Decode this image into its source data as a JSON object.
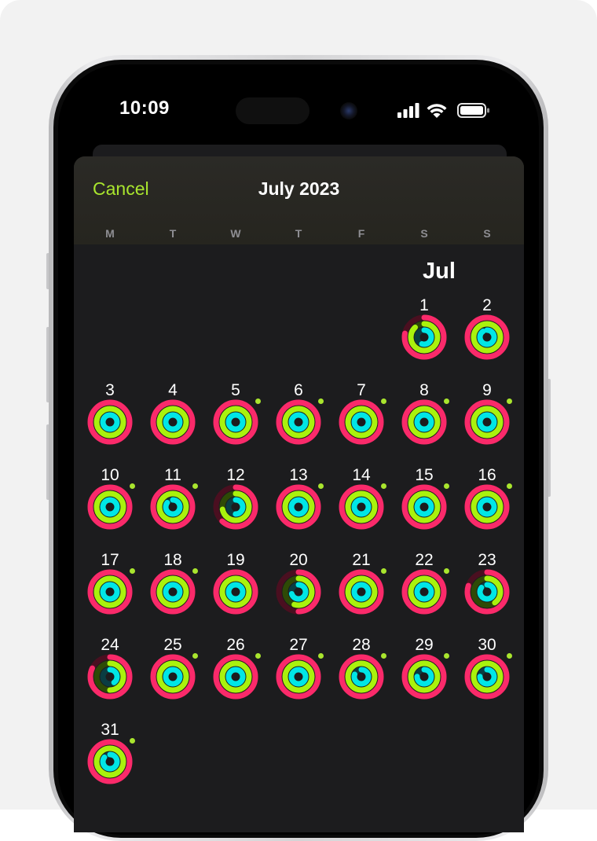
{
  "status_bar": {
    "time": "10:09",
    "icons": [
      "cellular-signal-icon",
      "wifi-icon",
      "battery-icon"
    ]
  },
  "header": {
    "cancel_label": "Cancel",
    "title": "July 2023"
  },
  "weekdays": [
    "M",
    "T",
    "W",
    "T",
    "F",
    "S",
    "S"
  ],
  "month_label": "Jul",
  "colors": {
    "move": "#fa2a6a",
    "move_track": "#4a0f20",
    "exercise": "#a9f20d",
    "exercise_track": "#2e4a06",
    "stand": "#00e6e6",
    "stand_track": "#0a3d42",
    "accent": "#a9e52e",
    "background": "#1c1c1e"
  },
  "days": [
    {
      "date": "1",
      "move": 0.78,
      "exercise": 0.88,
      "stand": 0.55,
      "badge": false
    },
    {
      "date": "2",
      "move": 1.0,
      "exercise": 1.0,
      "stand": 0.9,
      "badge": false
    },
    {
      "date": "3",
      "move": 1.0,
      "exercise": 1.0,
      "stand": 1.0,
      "badge": false
    },
    {
      "date": "4",
      "move": 1.0,
      "exercise": 1.0,
      "stand": 1.0,
      "badge": false
    },
    {
      "date": "5",
      "move": 1.0,
      "exercise": 1.0,
      "stand": 1.0,
      "badge": true
    },
    {
      "date": "6",
      "move": 1.0,
      "exercise": 1.0,
      "stand": 1.0,
      "badge": true
    },
    {
      "date": "7",
      "move": 1.0,
      "exercise": 1.0,
      "stand": 1.0,
      "badge": true
    },
    {
      "date": "8",
      "move": 1.0,
      "exercise": 1.0,
      "stand": 1.0,
      "badge": true
    },
    {
      "date": "9",
      "move": 1.0,
      "exercise": 1.0,
      "stand": 1.0,
      "badge": true
    },
    {
      "date": "10",
      "move": 1.0,
      "exercise": 1.0,
      "stand": 1.0,
      "badge": true
    },
    {
      "date": "11",
      "move": 1.0,
      "exercise": 1.0,
      "stand": 0.85,
      "badge": true
    },
    {
      "date": "12",
      "move": 0.62,
      "exercise": 0.72,
      "stand": 0.5,
      "badge": false
    },
    {
      "date": "13",
      "move": 1.0,
      "exercise": 1.0,
      "stand": 1.0,
      "badge": true
    },
    {
      "date": "14",
      "move": 1.0,
      "exercise": 1.0,
      "stand": 1.0,
      "badge": true
    },
    {
      "date": "15",
      "move": 1.0,
      "exercise": 1.0,
      "stand": 1.0,
      "badge": true
    },
    {
      "date": "16",
      "move": 1.0,
      "exercise": 1.0,
      "stand": 1.0,
      "badge": true
    },
    {
      "date": "17",
      "move": 1.0,
      "exercise": 1.0,
      "stand": 1.0,
      "badge": true
    },
    {
      "date": "18",
      "move": 1.0,
      "exercise": 1.0,
      "stand": 1.0,
      "badge": true
    },
    {
      "date": "19",
      "move": 1.0,
      "exercise": 1.0,
      "stand": 1.0,
      "badge": false
    },
    {
      "date": "20",
      "move": 0.5,
      "exercise": 0.55,
      "stand": 0.7,
      "badge": false
    },
    {
      "date": "21",
      "move": 1.0,
      "exercise": 1.0,
      "stand": 1.0,
      "badge": true
    },
    {
      "date": "22",
      "move": 1.0,
      "exercise": 1.0,
      "stand": 1.0,
      "badge": true
    },
    {
      "date": "23",
      "move": 0.8,
      "exercise": 0.4,
      "stand": 0.85,
      "badge": false
    },
    {
      "date": "24",
      "move": 0.82,
      "exercise": 0.5,
      "stand": 0.4,
      "badge": false
    },
    {
      "date": "25",
      "move": 1.0,
      "exercise": 1.0,
      "stand": 1.0,
      "badge": true
    },
    {
      "date": "26",
      "move": 1.0,
      "exercise": 1.0,
      "stand": 1.0,
      "badge": true
    },
    {
      "date": "27",
      "move": 1.0,
      "exercise": 1.0,
      "stand": 1.0,
      "badge": true
    },
    {
      "date": "28",
      "move": 1.0,
      "exercise": 1.0,
      "stand": 0.8,
      "badge": true
    },
    {
      "date": "29",
      "move": 1.0,
      "exercise": 1.0,
      "stand": 0.75,
      "badge": true
    },
    {
      "date": "30",
      "move": 1.0,
      "exercise": 1.0,
      "stand": 0.75,
      "badge": true
    },
    {
      "date": "31",
      "move": 1.0,
      "exercise": 1.0,
      "stand": 0.85,
      "badge": true
    }
  ]
}
